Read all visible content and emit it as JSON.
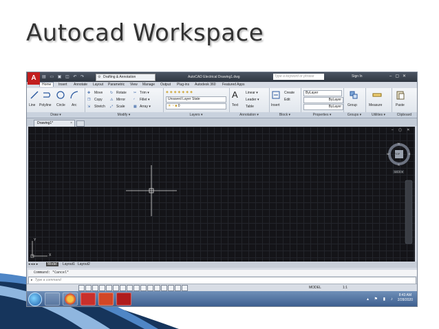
{
  "slide": {
    "title": "Autocad Workspace"
  },
  "titlebar": {
    "logo": "A",
    "workspace": "Drafting & Annotation",
    "title": "AutoCAD Electrical   Drawing1.dwg",
    "search_placeholder": "Type a keyword or phrase",
    "sign_in": "Sign In"
  },
  "tabs": [
    "Home",
    "Insert",
    "Annotate",
    "Layout",
    "Parametric",
    "View",
    "Manage",
    "Output",
    "Plug-ins",
    "Autodesk 360",
    "Featured Apps"
  ],
  "ribbon": {
    "draw": {
      "title": "Draw ▾",
      "items": [
        "Line",
        "Polyline",
        "Circle",
        "Arc"
      ]
    },
    "modify": {
      "title": "Modify ▾",
      "items": [
        "Move",
        "Rotate",
        "Trim ▾",
        "Copy",
        "Mirror",
        "Fillet ▾",
        "Stretch",
        "Scale",
        "Array ▾"
      ]
    },
    "layers": {
      "title": "Layers ▾",
      "state": "Unsaved Layer State",
      "current": "0"
    },
    "annotation": {
      "title": "Annotation ▾",
      "items": [
        "Text",
        "Linear ▾",
        "Leader ▾",
        "Table"
      ]
    },
    "block": {
      "title": "Block ▾",
      "items": [
        "Insert",
        "Create",
        "Edit"
      ]
    },
    "properties": {
      "title": "Properties ▾",
      "items": [
        "ByLayer",
        "ByLayer",
        "ByLayer"
      ]
    },
    "groups": {
      "title": "Groups ▾",
      "items": [
        "Group"
      ]
    },
    "utilities": {
      "title": "Utilities ▾",
      "items": [
        "Measure"
      ]
    },
    "clipboard": {
      "title": "Clipboard",
      "items": [
        "Paste"
      ]
    }
  },
  "file_tab": {
    "label": "Drawing1*",
    "close": "×"
  },
  "viewcube": {
    "n": "N",
    "s": "S",
    "e": "E",
    "w": "W",
    "top": "TOP",
    "wcs": "WCS ▾"
  },
  "ucs": {
    "y": "Y",
    "x": "X"
  },
  "layout_tabs": [
    "Model",
    "Layout1",
    "Layout2"
  ],
  "command": {
    "history": "Command: *Cancel*",
    "prompt": "Type a command"
  },
  "status": {
    "model": "MODEL",
    "scale": "1:1"
  },
  "taskbar": {
    "time": "8:43 AM",
    "date": "2/28/2020"
  }
}
